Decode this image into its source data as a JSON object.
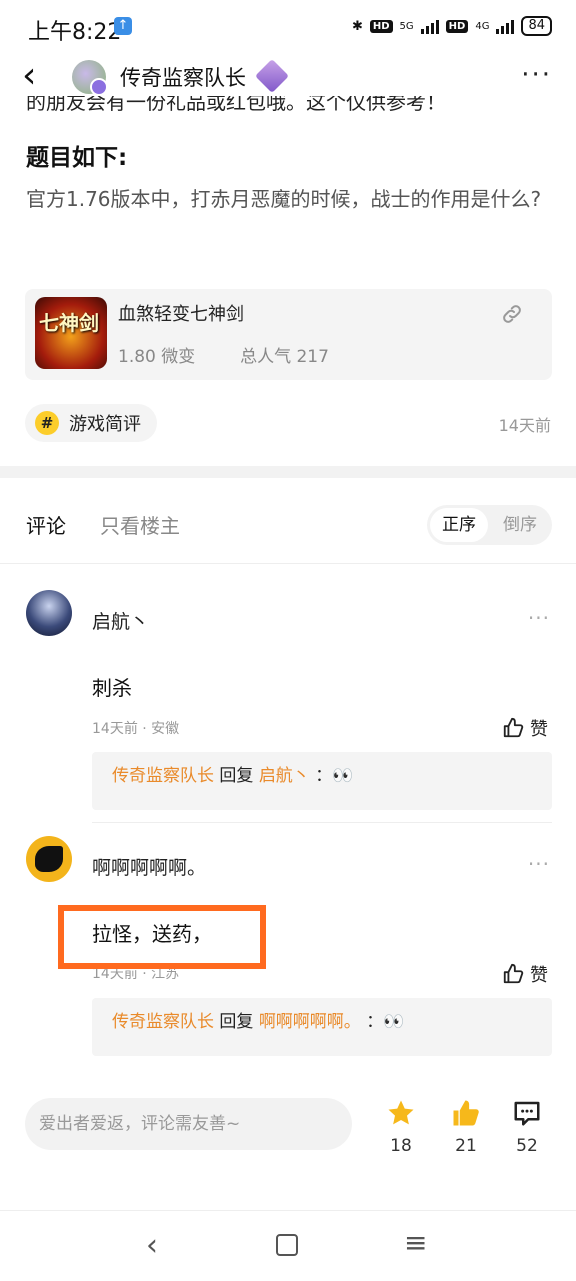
{
  "status": {
    "time": "上午8:22",
    "net1": "5G",
    "net2": "4G",
    "hd": "HD",
    "battery": "84"
  },
  "header": {
    "title": "传奇监察队长",
    "more": "···"
  },
  "post": {
    "cut_line": "的朋友会有一份礼品或红包哦。这个仅供参考！",
    "question_heading": "题目如下:",
    "question_body": "官方1.76版本中，打赤月恶魔的时候，战士的作用是什么?",
    "game": {
      "name": "血煞轻变七神剑",
      "version": "1.80 微变",
      "popularity": "总人气 217",
      "thumb_text": "七神剑"
    },
    "tag": {
      "hash": "#",
      "label": "游戏简评"
    },
    "time": "14天前"
  },
  "comments_header": {
    "tab_comments": "评论",
    "tab_op_only": "只看楼主",
    "sort_asc": "正序",
    "sort_desc": "倒序"
  },
  "comments": [
    {
      "name": "启航丶",
      "text": "刺杀",
      "meta": "14天前 · 安徽",
      "like": "赞",
      "reply": {
        "from": "传奇监察队长",
        "verb": "回复",
        "to": "启航丶",
        "sep": "：",
        "content": "👀"
      }
    },
    {
      "name": "啊啊啊啊啊。",
      "text": "拉怪，送药，",
      "meta": "14天前 · 江苏",
      "like": "赞",
      "reply": {
        "from": "传奇监察队长",
        "verb": "回复",
        "to": "啊啊啊啊啊。",
        "sep": "：",
        "content": "👀"
      }
    }
  ],
  "bottom": {
    "input_placeholder": "爱出者爱返，评论需友善~",
    "stars": "18",
    "likes": "21",
    "comments": "52"
  },
  "colors": {
    "accent": "#e98a2a",
    "highlight": "#ff6a1f",
    "star": "#f6b81b"
  }
}
